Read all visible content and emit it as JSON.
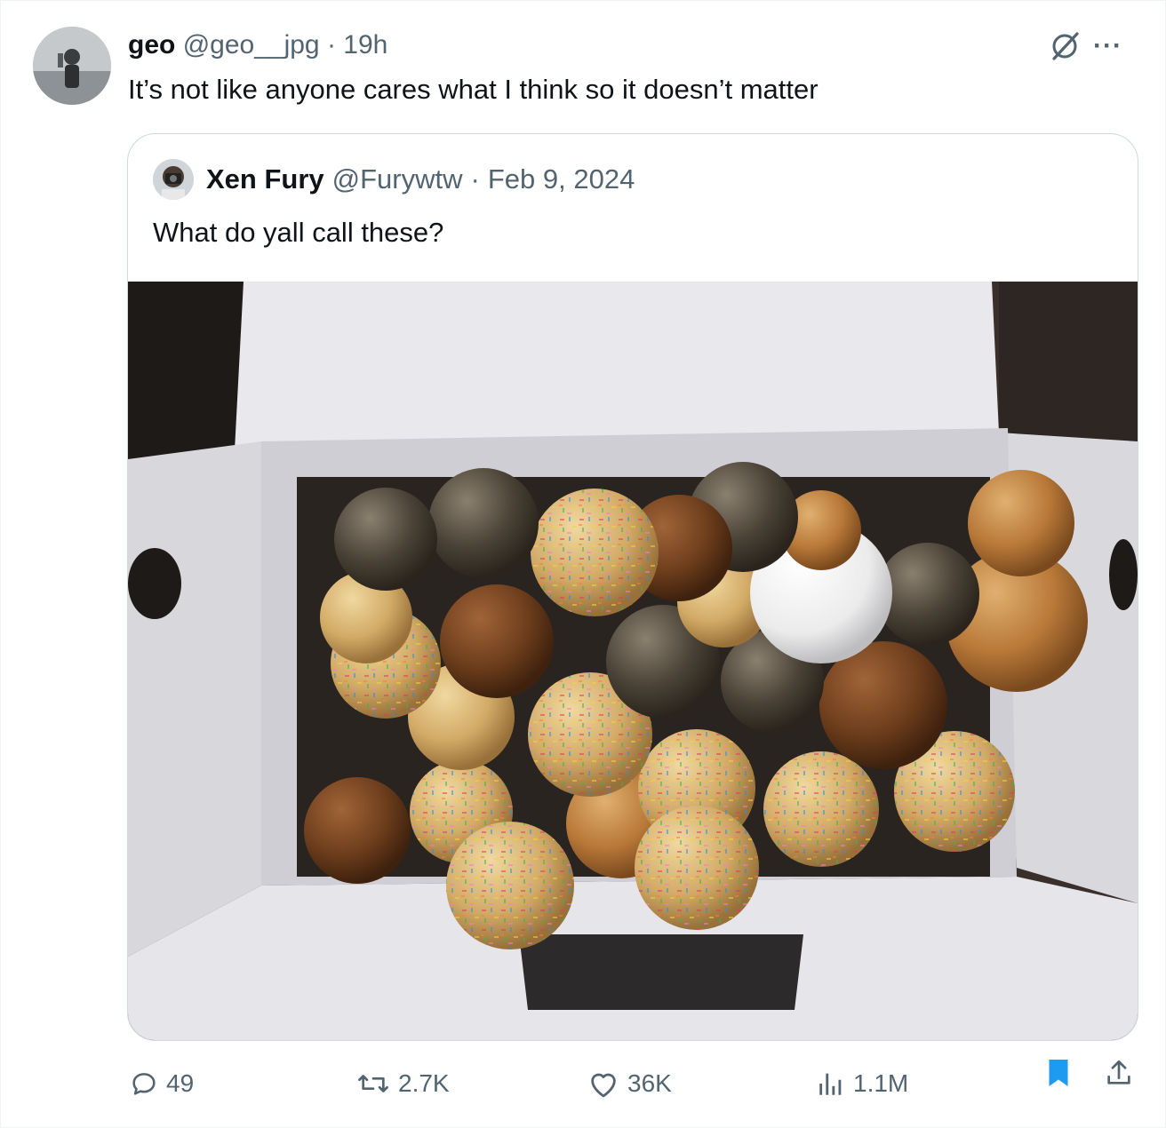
{
  "post": {
    "author_name": "geo",
    "author_handle": "@geo__jpg",
    "separator": "·",
    "time": "19h",
    "text": "It’s not like anyone cares what I think so it doesn’t matter",
    "more_label": "···"
  },
  "quote": {
    "author_name": "Xen Fury",
    "author_handle": "@Furywtw",
    "separator": "·",
    "date": "Feb 9, 2024",
    "text": "What do yall call these?",
    "image_subject": "box of donut holes with sprinkles and glazes"
  },
  "actions": {
    "replies": "49",
    "reposts": "2.7K",
    "likes": "36K",
    "views": "1.1M"
  },
  "colors": {
    "muted": "#536471",
    "bookmark": "#1d9bf0",
    "border": "#cfd9de"
  }
}
